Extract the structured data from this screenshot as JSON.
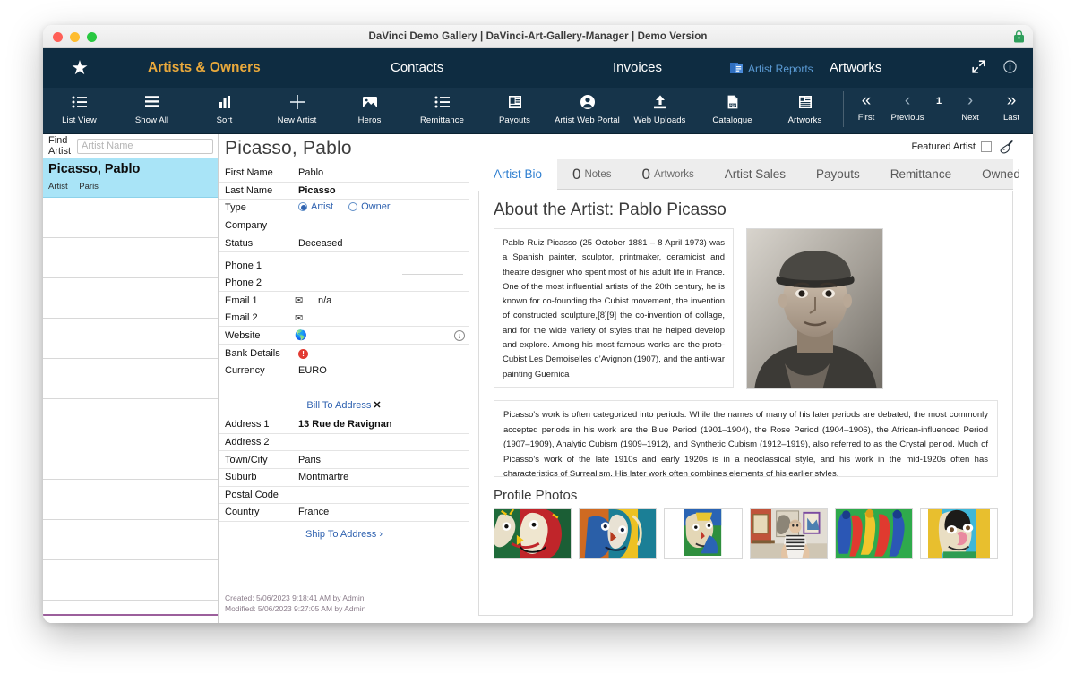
{
  "window": {
    "title": "DaVinci Demo Gallery | DaVinci-Art-Gallery-Manager | Demo Version",
    "lock_icon": "lock-icon",
    "accent_navy": "#0e2c41",
    "accent_toolbar": "#16344a",
    "accent_gold": "#e9a93c",
    "accent_blue": "#2f7fd0",
    "selection_blue": "#a9e4f7"
  },
  "nav": {
    "star_icon": "star-icon",
    "items": [
      {
        "label": "Artists & Owners"
      },
      {
        "label": "Contacts"
      },
      {
        "label": "Invoices"
      },
      {
        "label": "Artist Reports"
      },
      {
        "label": "Artworks"
      }
    ],
    "expand_icon": "expand-arrows-icon",
    "info_icon": "info-circle-icon"
  },
  "toolbar": {
    "tools": [
      {
        "label": "List View",
        "icon": "list-view-icon"
      },
      {
        "label": "Show All",
        "icon": "show-all-icon"
      },
      {
        "label": "Sort",
        "icon": "bar-chart-sort-icon"
      },
      {
        "label": "New Artist",
        "icon": "plus-icon"
      },
      {
        "label": "Heros",
        "icon": "image-icon"
      },
      {
        "label": "Remittance",
        "icon": "list-icon"
      },
      {
        "label": "Payouts",
        "icon": "document-icon"
      },
      {
        "label": "Artist Web Portal",
        "icon": "person-circle-icon"
      },
      {
        "label": "Web Uploads",
        "icon": "upload-icon"
      },
      {
        "label": "Catalogue",
        "icon": "pdf-icon"
      },
      {
        "label": "Artworks",
        "icon": "article-icon"
      }
    ],
    "pager": [
      {
        "label": "First",
        "icon": "double-chevron-left-icon"
      },
      {
        "label": "Previous",
        "icon": "chevron-left-icon"
      },
      {
        "label": "Next",
        "icon": "chevron-right-icon"
      },
      {
        "label": "Last",
        "icon": "double-chevron-right-icon"
      }
    ],
    "page_number": "1"
  },
  "find": {
    "label": "Find Artist",
    "placeholder": "Artist Name",
    "value": ""
  },
  "artist_list": {
    "rows": [
      {
        "name": "Picasso, Pablo",
        "type": "Artist",
        "city": "Paris",
        "selected": true
      },
      {
        "name": "",
        "type": "",
        "city": "",
        "selected": false
      },
      {
        "name": "",
        "type": "",
        "city": "",
        "selected": false
      },
      {
        "name": "",
        "type": "",
        "city": "",
        "selected": false
      },
      {
        "name": "",
        "type": "",
        "city": "",
        "selected": false
      },
      {
        "name": "",
        "type": "",
        "city": "",
        "selected": false
      },
      {
        "name": "",
        "type": "",
        "city": "",
        "selected": false
      },
      {
        "name": "",
        "type": "",
        "city": "",
        "selected": false
      },
      {
        "name": "",
        "type": "",
        "city": "",
        "selected": false
      },
      {
        "name": "",
        "type": "",
        "city": "",
        "selected": false
      },
      {
        "name": "",
        "type": "",
        "city": "",
        "selected": false
      }
    ]
  },
  "record": {
    "title": "Picasso, Pablo",
    "fields": {
      "first_name_label": "First Name",
      "first_name": "Pablo",
      "last_name_label": "Last Name",
      "last_name": "Picasso",
      "type_label": "Type",
      "type_artist": "Artist",
      "type_owner": "Owner",
      "type_selected": "Artist",
      "company_label": "Company",
      "company": "",
      "status_label": "Status",
      "status": "Deceased",
      "phone1_label": "Phone 1",
      "phone1": "",
      "phone2_label": "Phone 2",
      "phone2": "",
      "email1_label": "Email 1",
      "email1": "n/a",
      "email2_label": "Email 2",
      "email2": "",
      "website_label": "Website",
      "website": "",
      "bank_details_label": "Bank Details",
      "bank_details_alert": "!",
      "currency_label": "Currency",
      "currency": "EURO"
    },
    "bill_to": {
      "heading": "Bill To Address",
      "close_mark": "✕",
      "address1_label": "Address 1",
      "address1": "13 Rue de Ravignan",
      "address2_label": "Address 2",
      "address2": "",
      "town_label": "Town/City",
      "town": "Paris",
      "suburb_label": "Suburb",
      "suburb": "Montmartre",
      "postal_label": "Postal Code",
      "postal": "",
      "country_label": "Country",
      "country": "France"
    },
    "ship_to": {
      "heading": "Ship To Address",
      "chevron": "›"
    },
    "created": "Created: 5/06/2023 9:18:41 AM by Admin",
    "modified": "Modified: 5/06/2023 9:27:05 AM by Admin"
  },
  "featured": {
    "label": "Featured Artist",
    "checked": false,
    "brush_icon": "paintbrush-icon"
  },
  "tabs": [
    {
      "label": "Artist Bio",
      "count": "",
      "active": true
    },
    {
      "label": "Notes",
      "count": "0",
      "active": false
    },
    {
      "label": "Artworks",
      "count": "0",
      "active": false
    },
    {
      "label": "Artist Sales",
      "count": "",
      "active": false
    },
    {
      "label": "Payouts",
      "count": "",
      "active": false
    },
    {
      "label": "Remittance",
      "count": "",
      "active": false
    },
    {
      "label": "Owned",
      "count": "",
      "active": false
    }
  ],
  "bio": {
    "title": "About the Artist: Pablo Picasso",
    "paragraph1": "Pablo Ruiz Picasso (25 October 1881 – 8 April 1973) was a Spanish painter, sculptor, printmaker, ceramicist and theatre designer who spent most of his adult life in France. One of the most influential artists of the 20th century, he is known for co-founding the Cubist movement, the invention of constructed sculpture,[8][9] the co-invention of collage, and for the wide variety of styles that he helped develop and explore. Among his most famous works are the proto-Cubist Les Demoiselles d’Avignon (1907), and the anti-war painting Guernica",
    "paragraph2": "Picasso’s work is often categorized into periods. While the names of many of his later periods are debated, the most commonly accepted periods in his work are the Blue Period (1901–1904), the Rose Period (1904–1906), the African-influenced Period (1907–1909), Analytic Cubism (1909–1912), and Synthetic Cubism (1912–1919), also referred to as the Crystal period. Much of Picasso’s work of the late 1910s and early 1920s is in a neoclassical style, and his work in the mid-1920s often has characteristics of Surrealism. His later work often combines elements of his earlier styles.",
    "portrait_alt": "portrait-photo-picasso"
  },
  "photos": {
    "title": "Profile Photos",
    "items": [
      {
        "name": "profile-photo-1"
      },
      {
        "name": "profile-photo-2"
      },
      {
        "name": "profile-photo-3"
      },
      {
        "name": "profile-photo-4"
      },
      {
        "name": "profile-photo-5"
      },
      {
        "name": "profile-photo-6"
      }
    ]
  }
}
